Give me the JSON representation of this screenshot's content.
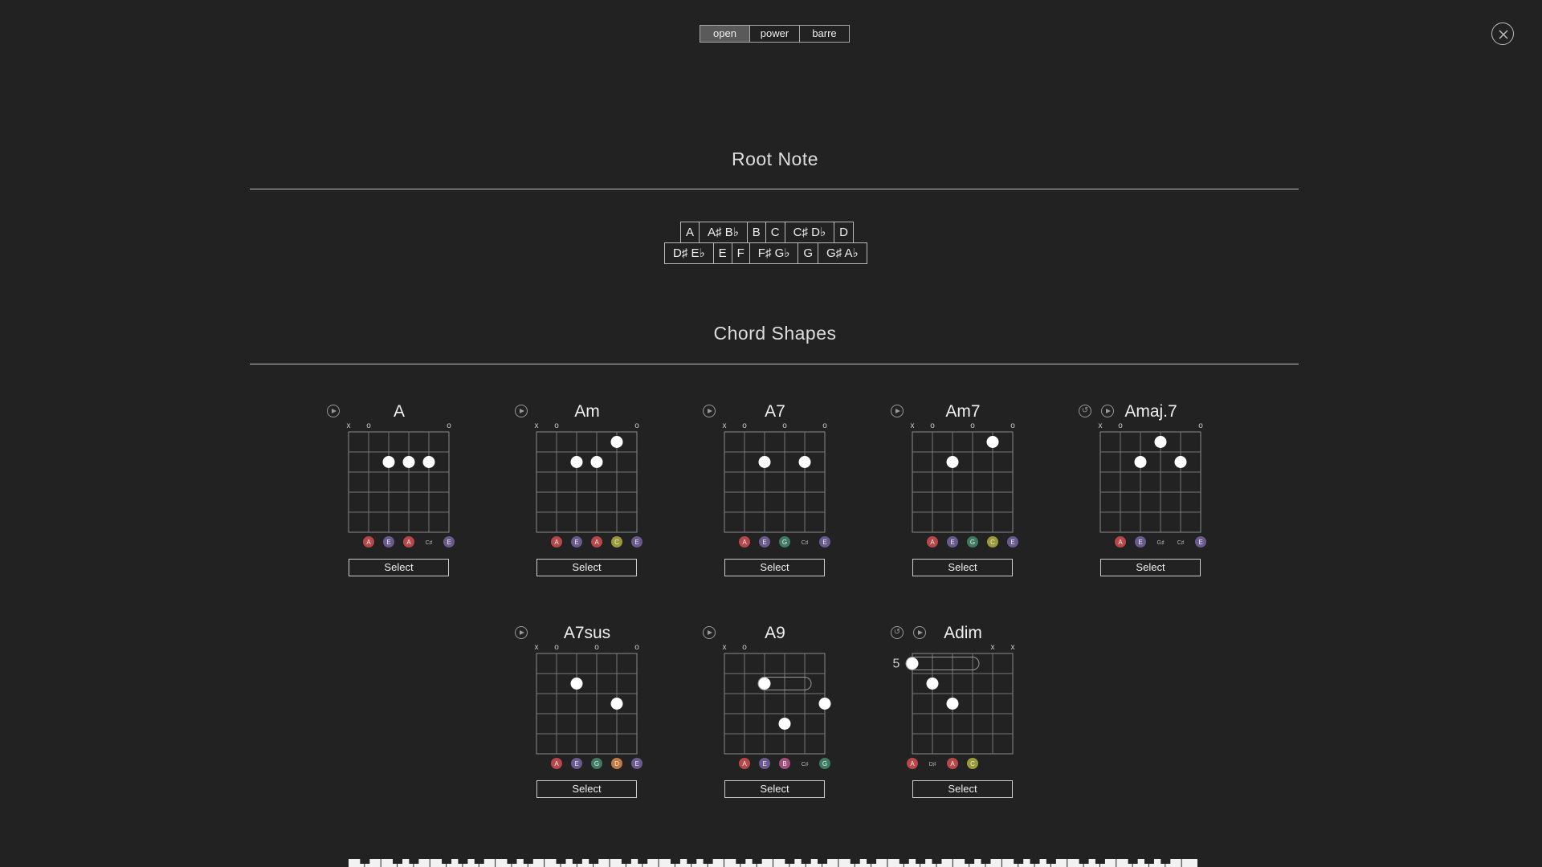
{
  "type_tabs": [
    {
      "label": "open",
      "active": true
    },
    {
      "label": "power",
      "active": false
    },
    {
      "label": "barre",
      "active": false
    }
  ],
  "sections": {
    "root_note": "Root Note",
    "chord_shapes": "Chord Shapes"
  },
  "root_notes": {
    "row1": [
      "A",
      "A♯ B♭",
      "B",
      "C",
      "C♯ D♭",
      "D"
    ],
    "row2": [
      "D♯ E♭",
      "E",
      "F",
      "F♯ G♭",
      "G",
      "G♯ A♭"
    ]
  },
  "select_label": "Select",
  "note_colors": {
    "A": "#b5484a",
    "E": "#6a5a8e",
    "C": "#9a9a3a",
    "G": "#3f7a62",
    "D": "#c27a40",
    "B": "#a0507a"
  },
  "chords": [
    {
      "name": "A",
      "alt": false,
      "markers": [
        "x",
        "o",
        "",
        "",
        "",
        "o"
      ],
      "dots": [
        [
          2,
          2
        ],
        [
          3,
          2
        ],
        [
          4,
          2
        ]
      ],
      "barres": [],
      "fret_label": "",
      "notes": [
        "",
        "A",
        "E",
        "A",
        "C♯",
        "E"
      ]
    },
    {
      "name": "Am",
      "alt": false,
      "markers": [
        "x",
        "o",
        "",
        "",
        "",
        "o"
      ],
      "dots": [
        [
          2,
          2
        ],
        [
          3,
          2
        ],
        [
          4,
          1
        ]
      ],
      "barres": [],
      "fret_label": "",
      "notes": [
        "",
        "A",
        "E",
        "A",
        "C",
        "E"
      ]
    },
    {
      "name": "A7",
      "alt": false,
      "markers": [
        "x",
        "o",
        "",
        "o",
        "",
        "o"
      ],
      "dots": [
        [
          2,
          2
        ],
        [
          4,
          2
        ]
      ],
      "barres": [],
      "fret_label": "",
      "notes": [
        "",
        "A",
        "E",
        "G",
        "C♯",
        "E"
      ]
    },
    {
      "name": "Am7",
      "alt": false,
      "markers": [
        "x",
        "o",
        "",
        "o",
        "",
        "o"
      ],
      "dots": [
        [
          2,
          2
        ],
        [
          4,
          1
        ]
      ],
      "barres": [],
      "fret_label": "",
      "notes": [
        "",
        "A",
        "E",
        "G",
        "C",
        "E"
      ]
    },
    {
      "name": "Amaj.7",
      "alt": true,
      "markers": [
        "x",
        "o",
        "",
        "",
        "",
        "o"
      ],
      "dots": [
        [
          2,
          2
        ],
        [
          3,
          1
        ],
        [
          4,
          2
        ]
      ],
      "barres": [],
      "fret_label": "",
      "notes": [
        "",
        "A",
        "E",
        "G♯",
        "C♯",
        "E"
      ]
    },
    {
      "name": "A7sus",
      "alt": false,
      "markers": [
        "x",
        "o",
        "",
        "o",
        "",
        "o"
      ],
      "dots": [
        [
          2,
          2
        ],
        [
          4,
          3
        ]
      ],
      "barres": [],
      "fret_label": "",
      "notes": [
        "",
        "A",
        "E",
        "G",
        "D",
        "E"
      ]
    },
    {
      "name": "A9",
      "alt": false,
      "markers": [
        "x",
        "o",
        "",
        "",
        "",
        ""
      ],
      "dots": [
        [
          2,
          2
        ],
        [
          3,
          4
        ],
        [
          5,
          3
        ]
      ],
      "barres": [
        [
          2,
          4,
          2
        ]
      ],
      "fret_label": "",
      "notes": [
        "",
        "A",
        "E",
        "B",
        "C♯",
        "G"
      ]
    },
    {
      "name": "Adim",
      "alt": true,
      "markers": [
        "",
        "",
        "",
        "",
        "x",
        "x"
      ],
      "dots": [
        [
          0,
          1
        ],
        [
          1,
          2
        ],
        [
          2,
          3
        ]
      ],
      "barres": [
        [
          0,
          3,
          1
        ]
      ],
      "fret_label": "5",
      "notes": [
        "A",
        "D♯",
        "A",
        "C",
        "",
        ""
      ]
    }
  ]
}
